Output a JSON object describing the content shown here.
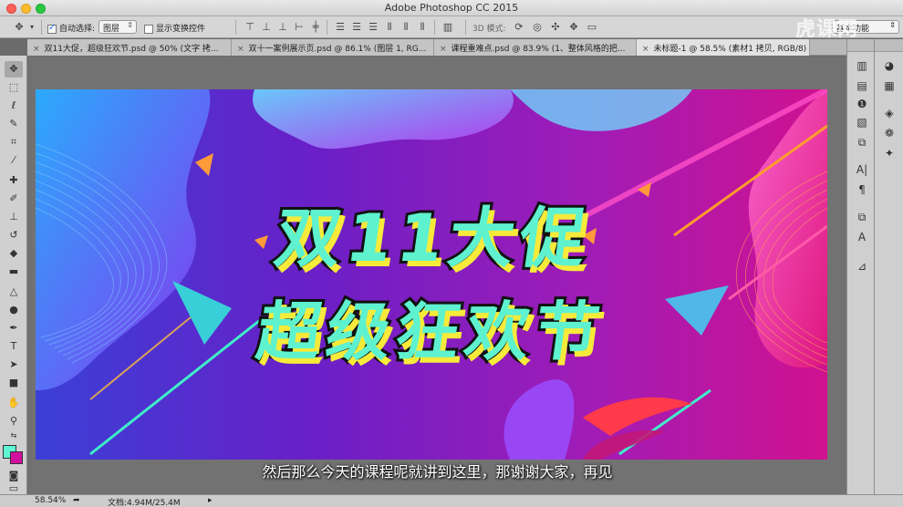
{
  "window": {
    "title": "Adobe Photoshop CC 2015"
  },
  "options_bar": {
    "auto_select_label": "自动选择:",
    "auto_select_value": "图层",
    "show_transform_label": "显示变换控件",
    "mode_3d_label": "3D 模式:",
    "workspace_value": "基本功能"
  },
  "tabs": [
    {
      "label": "双11大促，超级狂欢节.psd @ 50% (文字 拷..."
    },
    {
      "label": "双十一案例展示页.psd @ 86.1% (图层 1, RG..."
    },
    {
      "label": "课程重难点.psd @ 83.9% (1、整体风格的把..."
    },
    {
      "label": "未标题-1 @ 58.5% (素材1 拷贝, RGB/8)"
    }
  ],
  "canvas": {
    "headline_line1": "双11大促",
    "headline_line2": "超级狂欢节"
  },
  "subtitle": "然后那么今天的课程呢就讲到这里，那谢谢大家，再见",
  "watermark": "虎课网",
  "status": {
    "zoom": "58.54%",
    "doc_info": "文档:4.94M/25.4M"
  },
  "colors": {
    "foreground": "#5ff5d2",
    "background": "#d1109e",
    "headline_fill": "#5ef2cf",
    "headline_shadow": "#f6ea3a"
  },
  "toolbox_icons": [
    "move-icon",
    "marquee-icon",
    "lasso-icon",
    "quick-select-icon",
    "crop-icon",
    "eyedropper-icon",
    "healing-icon",
    "brush-icon",
    "stamp-icon",
    "history-brush-icon",
    "eraser-icon",
    "gradient-icon",
    "blur-icon",
    "dodge-icon",
    "pen-icon",
    "type-icon",
    "path-select-icon",
    "rectangle-icon",
    "hand-icon",
    "zoom-icon"
  ]
}
